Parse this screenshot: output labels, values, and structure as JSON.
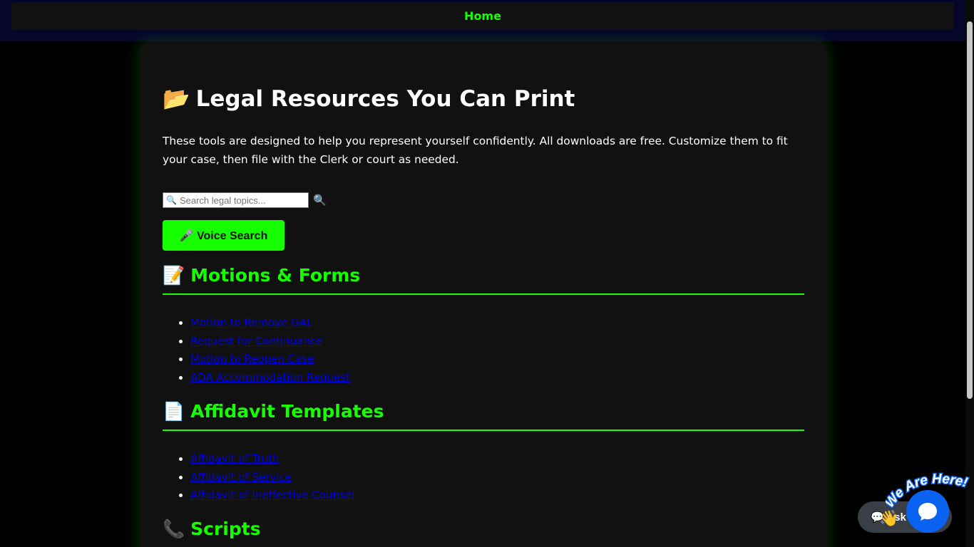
{
  "nav": {
    "home": "Home"
  },
  "page": {
    "title_emoji": "📂",
    "title": "Legal Resources You Can Print",
    "intro": "These tools are designed to help you represent yourself confidently. All downloads are free. Customize them to fit your case, then file with the Clerk or court as needed."
  },
  "search": {
    "icon": "🔍",
    "placeholder": "Search legal topics...",
    "button_icon": "🔍",
    "voice_label": "🎤 Voice Search"
  },
  "sections": [
    {
      "emoji": "📝",
      "title": "Motions & Forms",
      "links": [
        "Motion to Remove GAL",
        "Request for Continuance",
        "Motion to Reopen Case",
        "ADA Accommodation Request"
      ]
    },
    {
      "emoji": "📄",
      "title": "Affidavit Templates",
      "links": [
        "Affidavit of Truth",
        "Affidavit of Service",
        "Affidavit of Ineffective Counsel"
      ]
    },
    {
      "emoji": "📞",
      "title": "Scripts",
      "links": []
    }
  ],
  "chat": {
    "pill_label": "💬 Ask",
    "badge_text": "We Are Here!",
    "hand_icon": "👋"
  },
  "colors": {
    "accent": "#15ff00",
    "link": "#0000ee",
    "card_bg": "#111111",
    "page_bg": "#000000",
    "chat_blue": "#0a62f0"
  }
}
